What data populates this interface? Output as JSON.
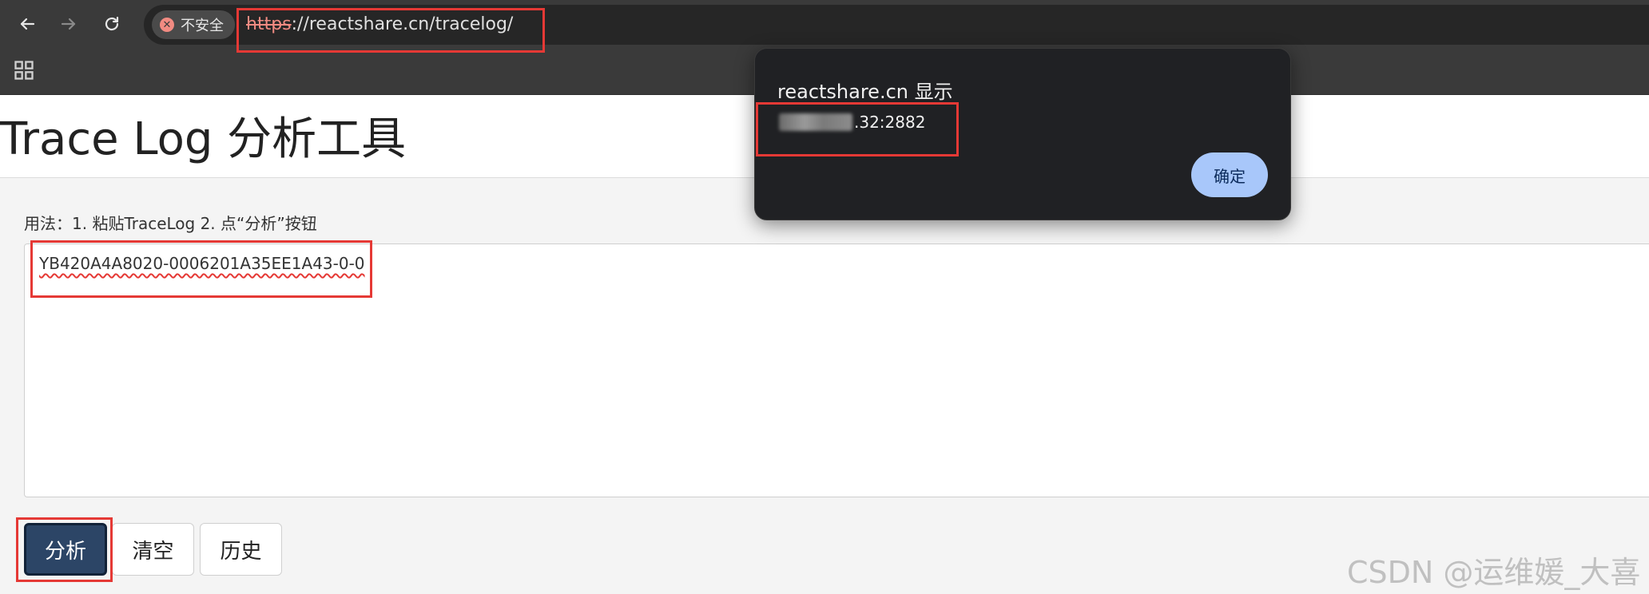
{
  "browser": {
    "security_label": "不安全",
    "url_scheme": "https",
    "url_rest": "://reactshare.cn/tracelog/"
  },
  "page": {
    "title": "Trace Log 分析工具",
    "usage": "用法：1. 粘贴TraceLog 2. 点“分析”按钮",
    "input_value": "YB420A4A8020-0006201A35EE1A43-0-0",
    "buttons": {
      "analyze": "分析",
      "clear": "清空",
      "history": "历史"
    }
  },
  "dialog": {
    "title": "reactshare.cn 显示",
    "message_visible": ".32:2882",
    "ok": "确定"
  },
  "watermark": "CSDN @运维媛_大喜",
  "colors": {
    "annotation_red": "#e53935",
    "primary_button": "#2c4566",
    "dialog_bg": "#202124",
    "dialog_ok": "#a8c7fa"
  }
}
